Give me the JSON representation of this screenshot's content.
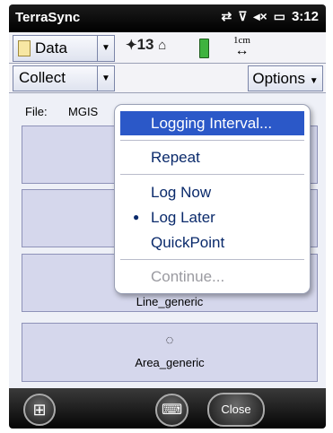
{
  "status_bar": {
    "app_title": "TerraSync",
    "time": "3:12",
    "icons": [
      "network-icon",
      "no-signal-icon",
      "volume-mute-icon",
      "battery-icon"
    ]
  },
  "toolbar": {
    "data_label": "Data",
    "gps_satellites": "13",
    "accuracy": "1cm"
  },
  "collect_toolbar": {
    "collect_label": "Collect",
    "options_label": "Options"
  },
  "file": {
    "label": "File:",
    "value": "MGIS"
  },
  "features": [
    {
      "name": ""
    },
    {
      "name": ""
    },
    {
      "name": "Line_generic"
    },
    {
      "name": "Area_generic"
    }
  ],
  "menu": {
    "items": [
      {
        "label": "Logging Interval...",
        "state": "selected"
      },
      {
        "label": "Repeat",
        "state": "normal"
      },
      {
        "label": "Log Now",
        "state": "normal"
      },
      {
        "label": "Log Later",
        "state": "checked"
      },
      {
        "label": "QuickPoint",
        "state": "normal"
      },
      {
        "label": "Continue...",
        "state": "disabled"
      }
    ]
  },
  "taskbar": {
    "close_label": "Close"
  }
}
